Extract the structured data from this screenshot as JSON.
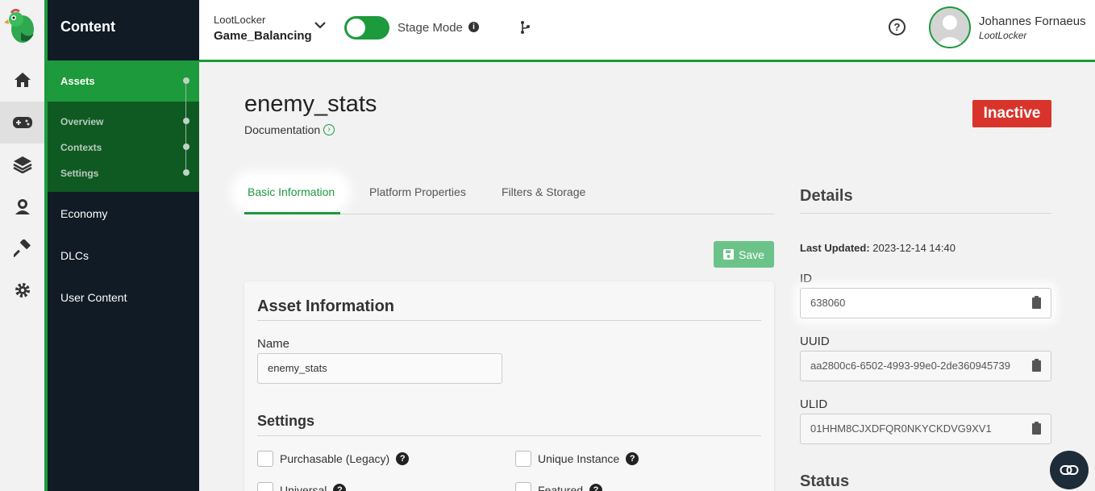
{
  "colors": {
    "accent": "#1d9a3c",
    "sidebar_bg": "#111b26",
    "inactive": "#d9342b"
  },
  "rail": {
    "logo": "parrot-logo",
    "items": [
      "home-icon",
      "gamepad-icon",
      "layers-icon",
      "player-icon",
      "hammer-icon",
      "settings-icon"
    ]
  },
  "sidebar": {
    "title": "Content",
    "active": "Assets",
    "sub_items": [
      "Overview",
      "Contexts",
      "Settings"
    ],
    "items": [
      "Economy",
      "DLCs",
      "User Content"
    ]
  },
  "topbar": {
    "org": "LootLocker",
    "game": "Game_Balancing",
    "stage_mode_label": "Stage Mode",
    "stage_mode_on": true,
    "user_name": "Johannes Fornaeus",
    "user_company": "LootLocker"
  },
  "page": {
    "title": "enemy_stats",
    "doc_link": "Documentation",
    "status_badge": "Inactive"
  },
  "tabs": [
    "Basic Information",
    "Platform Properties",
    "Filters & Storage"
  ],
  "save_label": "Save",
  "asset_info": {
    "heading": "Asset Information",
    "name_label": "Name",
    "name_value": "enemy_stats",
    "settings_heading": "Settings",
    "checkboxes": [
      "Purchasable (Legacy)",
      "Unique Instance",
      "Universal",
      "Featured"
    ]
  },
  "details": {
    "heading": "Details",
    "last_updated_label": "Last Updated:",
    "last_updated_value": "2023-12-14 14:40",
    "id_label": "ID",
    "id_value": "638060",
    "uuid_label": "UUID",
    "uuid_value": "aa2800c6-6502-4993-99e0-2de360945739",
    "ulid_label": "ULID",
    "ulid_value": "01HHM8CJXDFQR0NKYCKDVG9XV1",
    "status_heading": "Status"
  }
}
